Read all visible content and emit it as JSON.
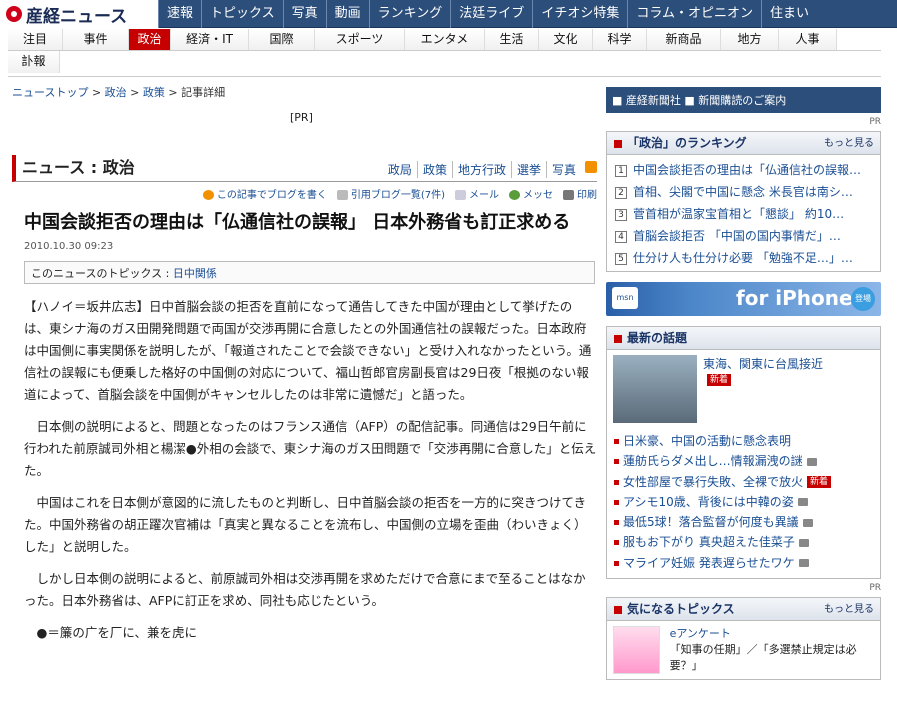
{
  "brand": {
    "logo_text": "産経ニュース"
  },
  "topnav": [
    "速報",
    "トピックス",
    "写真",
    "動画",
    "ランキング",
    "法廷ライブ",
    "イチオシ特集",
    "コラム・オピニオン",
    "住まい"
  ],
  "subnav": {
    "row1": [
      "注目",
      "事件",
      "政治",
      "経済・IT",
      "国際",
      "スポーツ",
      "エンタメ",
      "生活",
      "文化",
      "科学",
      "新商品",
      "地方",
      "人事"
    ],
    "row2": [
      "訃報"
    ],
    "active": "政治"
  },
  "breadcrumb": {
    "items": [
      "ニューストップ",
      "政治",
      "政策"
    ],
    "sep": " > ",
    "current": "記事詳細"
  },
  "pr_label": "[PR]",
  "section": {
    "title": "ニュース : 政治",
    "categories": [
      "政局",
      "政策",
      "地方行政",
      "選挙",
      "写真"
    ]
  },
  "tools": {
    "blog": "この記事でブログを書く",
    "trackback": "引用ブログ一覧(7件)",
    "mail": "メール",
    "messe": "メッセ",
    "print": "印刷"
  },
  "article": {
    "title": "中国会談拒否の理由は「仏通信社の誤報」 日本外務省も訂正求める",
    "date": "2010.10.30 09:23",
    "topic_label": "このニュースのトピックス : ",
    "topic_link": "日中関係",
    "paragraphs": [
      "【ハノイ＝坂井広志】日中首脳会談の拒否を直前になって通告してきた中国が理由として挙げたのは、東シナ海のガス田開発問題で両国が交渉再開に合意したとの外国通信社の誤報だった。日本政府は中国側に事実関係を説明したが、「報道されたことで会談できない」と受け入れなかったという。通信社の誤報にも便乗した格好の中国側の対応について、福山哲郎官房副長官は29日夜「根拠のない報道によって、首脳会談を中国側がキャンセルしたのは非常に遺憾だ」と語った。",
      "日本側の説明によると、問題となったのはフランス通信（AFP）の配信記事。同通信は29日午前に行われた前原誠司外相と楊潔●外相の会談で、東シナ海のガス田問題で「交渉再開に合意した」と伝えた。",
      "中国はこれを日本側が意図的に流したものと判断し、日中首脳会談の拒否を一方的に突きつけてきた。中国外務省の胡正躍次官補は「真実と異なることを流布し、中国側の立場を歪曲（わいきょく）した」と説明した。",
      "しかし日本側の説明によると、前原誠司外相は交渉再開を求めただけで合意にまで至ることはなかった。日本外務省は、AFPに訂正を求め、同社も応じたという。",
      "●＝簾の广を厂に、兼を虎に"
    ]
  },
  "right": {
    "banner": "■ 産経新聞社 ■ 新聞購読のご案内",
    "pr": "PR",
    "ranking": {
      "title": "「政治」のランキング",
      "more": "もっと見る",
      "items": [
        "中国会談拒否の理由は「仏通信社の誤報…",
        "首相、尖閣で中国に懸念 米長官は南シ…",
        "菅首相が温家宝首相と「懇談」 約10…",
        "首脳会談拒否 「中国の国内事情だ」…",
        "仕分け人も仕分け必要 「勉強不足…」…"
      ]
    },
    "iphone": {
      "logo": "msn",
      "text": "for iPhone",
      "badge": "登場"
    },
    "news": {
      "title": "最新の話題",
      "feature": "東海、関東に台風接近",
      "feature_badge": "新着",
      "items": [
        "日米豪、中国の活動に懸念表明",
        "蓮舫氏らダメ出し…情報漏洩の謎",
        "女性部屋で暴行失敗、全裸で放火",
        "アシモ10歳、背後には中韓の姿",
        "最低5球！落合監督が何度も異議",
        "服もお下がり 真央超えた佳菜子",
        "マライア妊娠 発表遅らせたワケ"
      ],
      "new_badge": "新着"
    },
    "topics": {
      "title": "気になるトピックス",
      "more": "もっと見る",
      "label": "eアンケート",
      "text": "「知事の任期」／「多選禁止規定は必要？」"
    }
  }
}
